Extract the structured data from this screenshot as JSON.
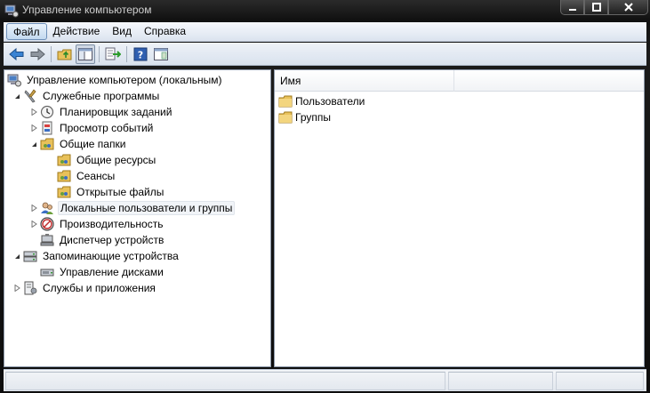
{
  "window": {
    "title": "Управление компьютером"
  },
  "menu": {
    "items": [
      "Файл",
      "Действие",
      "Вид",
      "Справка"
    ],
    "active_index": 0
  },
  "toolbar": {
    "buttons": [
      "back-arrow",
      "forward-arrow",
      "up-folder",
      "show-hide-tree",
      "export-list",
      "help",
      "properties"
    ]
  },
  "tree": {
    "items": [
      {
        "label": "Управление компьютером (локальным)",
        "icon": "computer-management-icon",
        "level": 0,
        "expand": "none"
      },
      {
        "label": "Служебные программы",
        "icon": "system-tools-icon",
        "level": 1,
        "expand": "open"
      },
      {
        "label": "Планировщик заданий",
        "icon": "task-scheduler-icon",
        "level": 2,
        "expand": "closed"
      },
      {
        "label": "Просмотр событий",
        "icon": "event-viewer-icon",
        "level": 2,
        "expand": "closed"
      },
      {
        "label": "Общие папки",
        "icon": "shared-folders-icon",
        "level": 2,
        "expand": "open"
      },
      {
        "label": "Общие ресурсы",
        "icon": "shares-icon",
        "level": 3,
        "expand": "none"
      },
      {
        "label": "Сеансы",
        "icon": "sessions-icon",
        "level": 3,
        "expand": "none"
      },
      {
        "label": "Открытые файлы",
        "icon": "open-files-icon",
        "level": 3,
        "expand": "none"
      },
      {
        "label": "Локальные пользователи и группы",
        "icon": "local-users-groups-icon",
        "level": 2,
        "expand": "closed",
        "hover": true
      },
      {
        "label": "Производительность",
        "icon": "performance-icon",
        "level": 2,
        "expand": "closed"
      },
      {
        "label": "Диспетчер устройств",
        "icon": "device-manager-icon",
        "level": 2,
        "expand": "none"
      },
      {
        "label": "Запоминающие устройства",
        "icon": "storage-icon",
        "level": 1,
        "expand": "open"
      },
      {
        "label": "Управление дисками",
        "icon": "disk-management-icon",
        "level": 2,
        "expand": "none"
      },
      {
        "label": "Службы и приложения",
        "icon": "services-applications-icon",
        "level": 1,
        "expand": "closed"
      }
    ]
  },
  "list": {
    "column_name": "Имя",
    "items": [
      "Пользователи",
      "Группы"
    ]
  },
  "colors": {
    "folder": "#e8c15a",
    "accent_blue": "#2f6fb8",
    "hover_bg": "#f1f4f8"
  }
}
